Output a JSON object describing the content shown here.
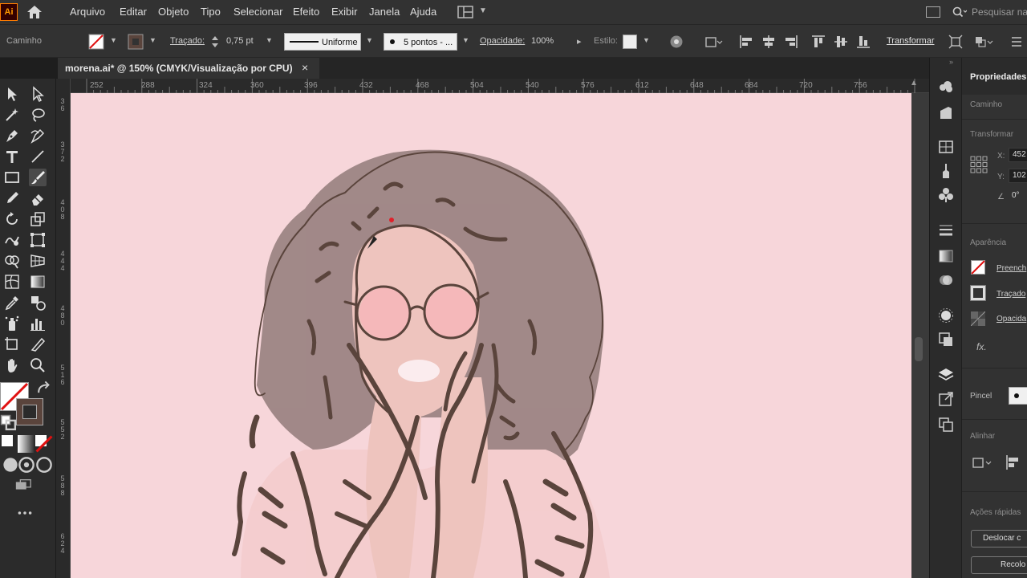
{
  "app": {
    "logo": "Ai"
  },
  "menubar": {
    "items": [
      "Arquivo",
      "Editar",
      "Objeto",
      "Tipo",
      "Selecionar",
      "Efeito",
      "Exibir",
      "Janela",
      "Ajuda"
    ],
    "search_placeholder": "Pesquisar na"
  },
  "controlbar": {
    "selection_label": "Caminho",
    "stroke_label": "Traçado:",
    "stroke_weight": "0,75 pt",
    "profile_label": "Uniforme",
    "brush_label": "5 pontos - ...",
    "opacity_label": "Opacidade:",
    "opacity_value": "100%",
    "style_label": "Estilo:",
    "transform_label": "Transformar"
  },
  "document": {
    "tab_title": "morena.ai* @ 150% (CMYK/Visualização por CPU)",
    "close_glyph": "×"
  },
  "rulers": {
    "top": [
      "252",
      "288",
      "324",
      "360",
      "396",
      "432",
      "468",
      "504",
      "540",
      "576",
      "612",
      "648",
      "684",
      "720",
      "756"
    ],
    "left": [
      [
        "3",
        "6"
      ],
      [
        "3",
        "7",
        "2"
      ],
      [
        "4",
        "0",
        "8"
      ],
      [
        "4",
        "4",
        "4"
      ],
      [
        "4",
        "8",
        "0"
      ],
      [
        "5",
        "1",
        "6"
      ],
      [
        "5",
        "5",
        "2"
      ],
      [
        "5",
        "8",
        "8"
      ],
      [
        "6",
        "2",
        "4"
      ]
    ]
  },
  "properties": {
    "title": "Propriedades",
    "selection": "Caminho",
    "transform_heading": "Transformar",
    "x_label": "X:",
    "x_value": "452",
    "y_label": "Y:",
    "y_value": "102",
    "angle_label": "0°",
    "appearance_heading": "Aparência",
    "fill_label": "Preench",
    "stroke_label": "Traçado",
    "opacity_label": "Opacida",
    "fx_label": "fx.",
    "brush_label": "Pincel",
    "align_heading": "Alinhar",
    "quick_actions_heading": "Ações rápidas",
    "offset_button": "Deslocar c",
    "recolor_button": "Recolo"
  },
  "colors": {
    "canvas": "#f7d6da",
    "accent": "#ff9a00",
    "stroke_line": "#5a443c",
    "ui_dark": "#323232"
  }
}
